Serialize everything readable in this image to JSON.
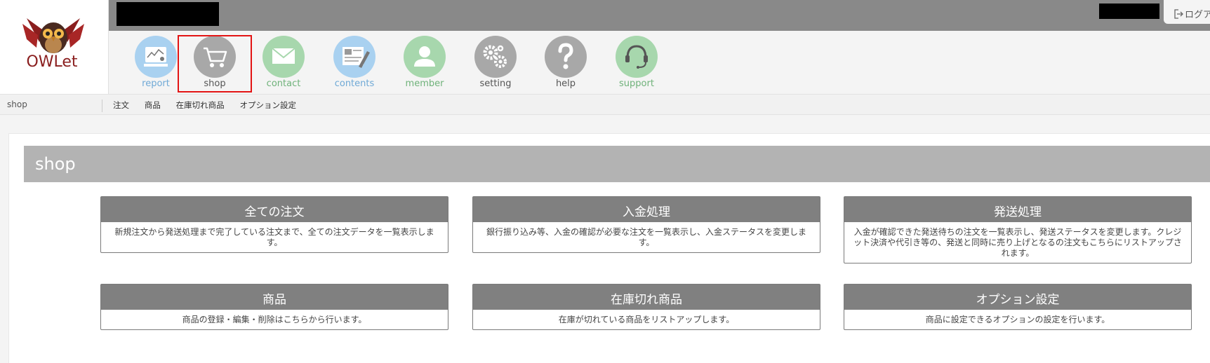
{
  "logo": {
    "text": "OWLet"
  },
  "header": {
    "logout_label": "ログア"
  },
  "nav": {
    "items": [
      {
        "label": "report",
        "color": "#6fa9d6",
        "circle": "#a9d1f0",
        "icon": "report-icon"
      },
      {
        "label": "shop",
        "color": "#555555",
        "circle": "#a8a8a8",
        "icon": "cart-icon"
      },
      {
        "label": "contact",
        "color": "#6fb27a",
        "circle": "#a7d7ad",
        "icon": "mail-icon"
      },
      {
        "label": "contents",
        "color": "#6fa9d6",
        "circle": "#a9d1f0",
        "icon": "document-pen-icon"
      },
      {
        "label": "member",
        "color": "#6fb27a",
        "circle": "#a7d7ad",
        "icon": "person-icon"
      },
      {
        "label": "setting",
        "color": "#555555",
        "circle": "#a8a8a8",
        "icon": "gears-icon"
      },
      {
        "label": "help",
        "color": "#555555",
        "circle": "#a8a8a8",
        "icon": "question-icon"
      },
      {
        "label": "support",
        "color": "#6fb27a",
        "circle": "#a7d7ad",
        "icon": "headset-icon"
      }
    ],
    "active": "shop"
  },
  "subnav": {
    "title": "shop",
    "links": [
      "注文",
      "商品",
      "在庫切れ商品",
      "オプション設定"
    ]
  },
  "main": {
    "heading": "shop",
    "cards": [
      {
        "title": "全ての注文",
        "desc": "新規注文から発送処理まで完了している注文まで、全ての注文データを一覧表示します。"
      },
      {
        "title": "入金処理",
        "desc": "銀行振り込み等、入金の確認が必要な注文を一覧表示し、入金ステータスを変更します。"
      },
      {
        "title": "発送処理",
        "desc": "入金が確認できた発送待ちの注文を一覧表示し、発送ステータスを変更します。クレジット決済や代引き等の、発送と同時に売り上げとなるの注文もこちらにリストアップされます。"
      },
      {
        "title": "商品",
        "desc": "商品の登録・編集・削除はこちらから行います。"
      },
      {
        "title": "在庫切れ商品",
        "desc": "在庫が切れている商品をリストアップします。"
      },
      {
        "title": "オプション設定",
        "desc": "商品に設定できるオプションの設定を行います。"
      }
    ]
  }
}
